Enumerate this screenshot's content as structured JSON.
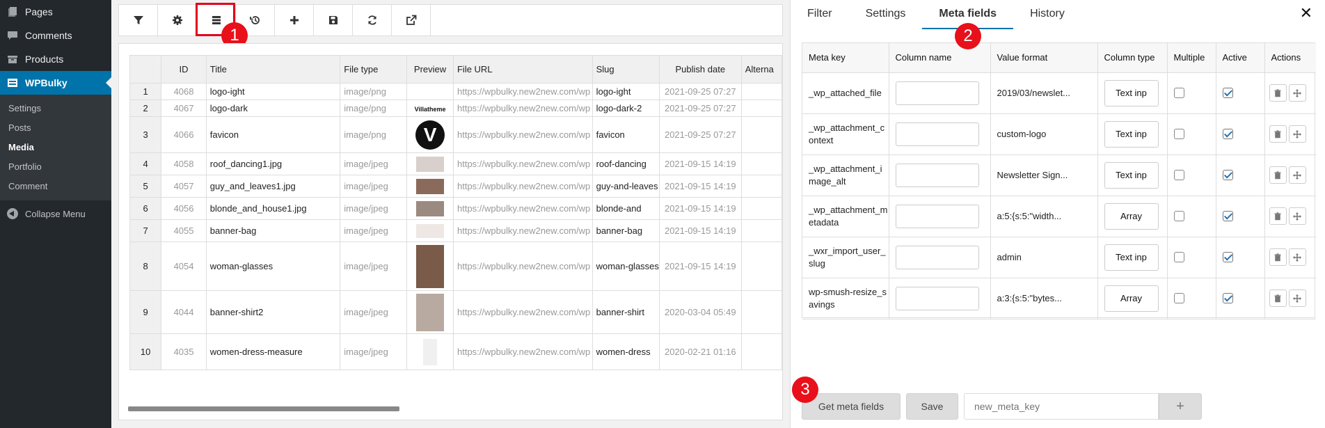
{
  "sidebar": {
    "top_items": [
      {
        "label": "Pages",
        "icon": "pages-icon"
      },
      {
        "label": "Comments",
        "icon": "comments-icon"
      },
      {
        "label": "Products",
        "icon": "products-icon"
      }
    ],
    "active_item": {
      "label": "WPBulky",
      "icon": "wpbulky-icon"
    },
    "sub_items": [
      "Settings",
      "Posts",
      "Media",
      "Portfolio",
      "Comment"
    ],
    "current_sub": "Media",
    "collapse_label": "Collapse Menu"
  },
  "toolbar": {
    "buttons": [
      "filter-icon",
      "gear-icon",
      "columns-icon",
      "history-icon",
      "plus-icon",
      "save-icon",
      "refresh-icon",
      "export-icon"
    ]
  },
  "badges": [
    "1",
    "2",
    "3"
  ],
  "grid": {
    "columns": [
      "",
      "ID",
      "Title",
      "File type",
      "Preview",
      "File URL",
      "Slug",
      "Publish date",
      "Alterna"
    ],
    "rows": [
      {
        "n": "1",
        "id": "4068",
        "title": "logo-ight",
        "type": "image/png",
        "url": "https://wpbulky.new2new.com/wp",
        "slug": "logo-ight",
        "date": "2021-09-25 07:27",
        "thumb": "none"
      },
      {
        "n": "2",
        "id": "4067",
        "title": "logo-dark",
        "type": "image/png",
        "url": "https://wpbulky.new2new.com/wp",
        "slug": "logo-dark-2",
        "date": "2021-09-25 07:27",
        "thumb": "logo-text",
        "thumb_text": "Villatheme"
      },
      {
        "n": "3",
        "id": "4066",
        "title": "favicon",
        "type": "image/png",
        "url": "https://wpbulky.new2new.com/wp",
        "slug": "favicon",
        "date": "2021-09-25 07:27",
        "thumb": "v-circle",
        "thumb_text": "V"
      },
      {
        "n": "4",
        "id": "4058",
        "title": "roof_dancing1.jpg",
        "type": "image/jpeg",
        "url": "https://wpbulky.new2new.com/wp",
        "slug": "roof-dancing",
        "date": "2021-09-15 14:19",
        "thumb": "photo"
      },
      {
        "n": "5",
        "id": "4057",
        "title": "guy_and_leaves1.jpg",
        "type": "image/jpeg",
        "url": "https://wpbulky.new2new.com/wp",
        "slug": "guy-and-leaves",
        "date": "2021-09-15 14:19",
        "thumb": "photo"
      },
      {
        "n": "6",
        "id": "4056",
        "title": "blonde_and_house1.jpg",
        "type": "image/jpeg",
        "url": "https://wpbulky.new2new.com/wp",
        "slug": "blonde-and",
        "date": "2021-09-15 14:19",
        "thumb": "photo"
      },
      {
        "n": "7",
        "id": "4055",
        "title": "banner-bag",
        "type": "image/jpeg",
        "url": "https://wpbulky.new2new.com/wp",
        "slug": "banner-bag",
        "date": "2021-09-15 14:19",
        "thumb": "photo-light"
      },
      {
        "n": "8",
        "id": "4054",
        "title": "woman-glasses",
        "type": "image/jpeg",
        "url": "https://wpbulky.new2new.com/wp",
        "slug": "woman-glasses",
        "date": "2021-09-15 14:19",
        "thumb": "photo-tall"
      },
      {
        "n": "9",
        "id": "4044",
        "title": "banner-shirt2",
        "type": "image/jpeg",
        "url": "https://wpbulky.new2new.com/wp",
        "slug": "banner-shirt",
        "date": "2020-03-04 05:49",
        "thumb": "photo-tall"
      },
      {
        "n": "10",
        "id": "4035",
        "title": "women-dress-measure",
        "type": "image/jpeg",
        "url": "https://wpbulky.new2new.com/wp",
        "slug": "women-dress",
        "date": "2020-02-21 01:16",
        "thumb": "photo-white"
      }
    ]
  },
  "panel": {
    "tabs": [
      "Filter",
      "Settings",
      "Meta fields",
      "History"
    ],
    "active_tab": "Meta fields",
    "close": "✕",
    "meta_columns": [
      "Meta key",
      "Column name",
      "Value format",
      "Column type",
      "Multiple",
      "Active",
      "Actions"
    ],
    "meta_rows": [
      {
        "key": "_wp_attached_file",
        "format": "2019/03/newslet...",
        "type": "Text inp",
        "multiple": false,
        "active": true
      },
      {
        "key": "_wp_attachment_context",
        "format": "custom-logo",
        "type": "Text inp",
        "multiple": false,
        "active": true
      },
      {
        "key": "_wp_attachment_image_alt",
        "format": "Newsletter Sign...",
        "type": "Text inp",
        "multiple": false,
        "active": true
      },
      {
        "key": "_wp_attachment_metadata",
        "format": "a:5:{s:5:\"width...",
        "type": "Array",
        "multiple": false,
        "active": true
      },
      {
        "key": "_wxr_import_user_slug",
        "format": "admin",
        "type": "Text inp",
        "multiple": false,
        "active": true
      },
      {
        "key": "wp-smush-resize_savings",
        "format": "a:3:{s:5:\"bytes...",
        "type": "Array",
        "multiple": false,
        "active": true
      }
    ],
    "get_meta_label": "Get meta fields",
    "save_label": "Save",
    "new_key_placeholder": "new_meta_key",
    "add_label": "+"
  },
  "colors": {
    "accent": "#0073aa",
    "sidebar_bg": "#23282d",
    "badge": "#e8101a"
  }
}
